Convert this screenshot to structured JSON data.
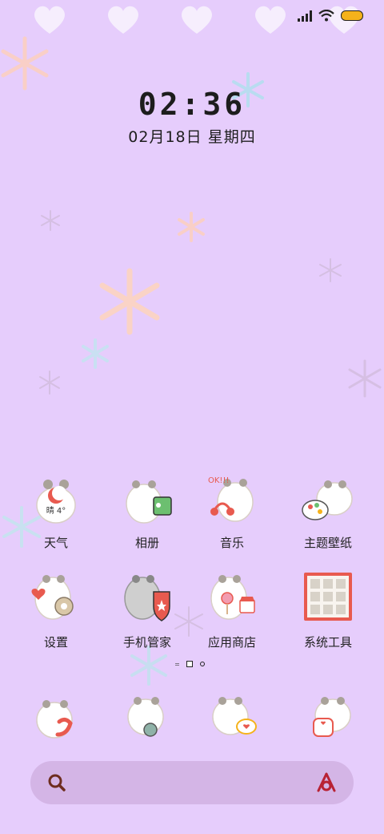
{
  "status_bar": {
    "signal_icon": "signal-icon",
    "wifi_icon": "wifi-icon",
    "battery_icon": "battery-icon",
    "battery_color": "#f5b21b"
  },
  "clock": {
    "time": "02:36",
    "date": "02月18日  星期四"
  },
  "apps": [
    {
      "label": "天气",
      "icon": "weather-icon",
      "badge": "晴 4°"
    },
    {
      "label": "相册",
      "icon": "gallery-icon"
    },
    {
      "label": "音乐",
      "icon": "music-icon"
    },
    {
      "label": "主题壁纸",
      "icon": "theme-wallpaper-icon"
    },
    {
      "label": "设置",
      "icon": "settings-icon"
    },
    {
      "label": "手机管家",
      "icon": "phone-manager-icon"
    },
    {
      "label": "应用商店",
      "icon": "app-store-icon"
    },
    {
      "label": "系统工具",
      "icon": "system-tools-icon"
    }
  ],
  "dock": [
    {
      "icon": "phone-icon"
    },
    {
      "icon": "contacts-icon"
    },
    {
      "icon": "messages-icon"
    },
    {
      "icon": "browser-icon"
    }
  ],
  "page_indicator": {
    "pages": 3,
    "current": 2
  },
  "search_bar": {
    "search_icon": "search-icon",
    "assistant_icon": "assistant-icon"
  },
  "colors": {
    "background": "#e6cdfc",
    "search_bar": "#d4b5e6",
    "accent": "#e85a4f"
  }
}
